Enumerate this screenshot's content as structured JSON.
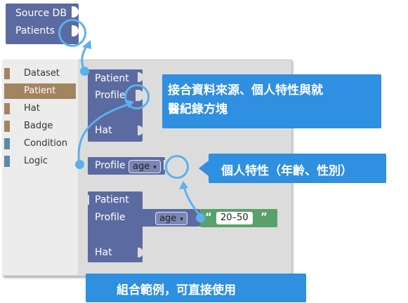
{
  "source_block": {
    "title": "Source DB",
    "output": "Patients"
  },
  "toolbox": {
    "categories": [
      {
        "label": "Dataset",
        "color": "#a38460"
      },
      {
        "label": "Patient",
        "color": "#a38460"
      },
      {
        "label": "Hat",
        "color": "#a38460"
      },
      {
        "label": "Badge",
        "color": "#a38460"
      },
      {
        "label": "Condition",
        "color": "#5b8ba8"
      },
      {
        "label": "Logic",
        "color": "#5b8ba8"
      }
    ],
    "selected": "Patient"
  },
  "patient_block": {
    "title": "Patient",
    "profile_label": "Profile",
    "hat_label": "Hat"
  },
  "profile_block": {
    "label": "Profile",
    "dropdown_value": "age",
    "dropdown_arrow": "▾"
  },
  "example_block": {
    "title": "Patient",
    "profile_label": "Profile",
    "hat_label": "Hat",
    "dropdown_value": "age",
    "dropdown_arrow": "▾",
    "open_quote": "“",
    "close_quote": "”",
    "string_value": "20–50"
  },
  "callouts": {
    "connect": "接合資料來源、個人特性與就\n醫紀錄方塊",
    "attribute": "個人特性（年齡、性別）",
    "example": "組合範例，可直接使用"
  },
  "colors": {
    "block": "#5b6aa0",
    "string_block": "#5aa06a",
    "callout": "#2f8fe0",
    "highlight": "#5ab1ec"
  }
}
